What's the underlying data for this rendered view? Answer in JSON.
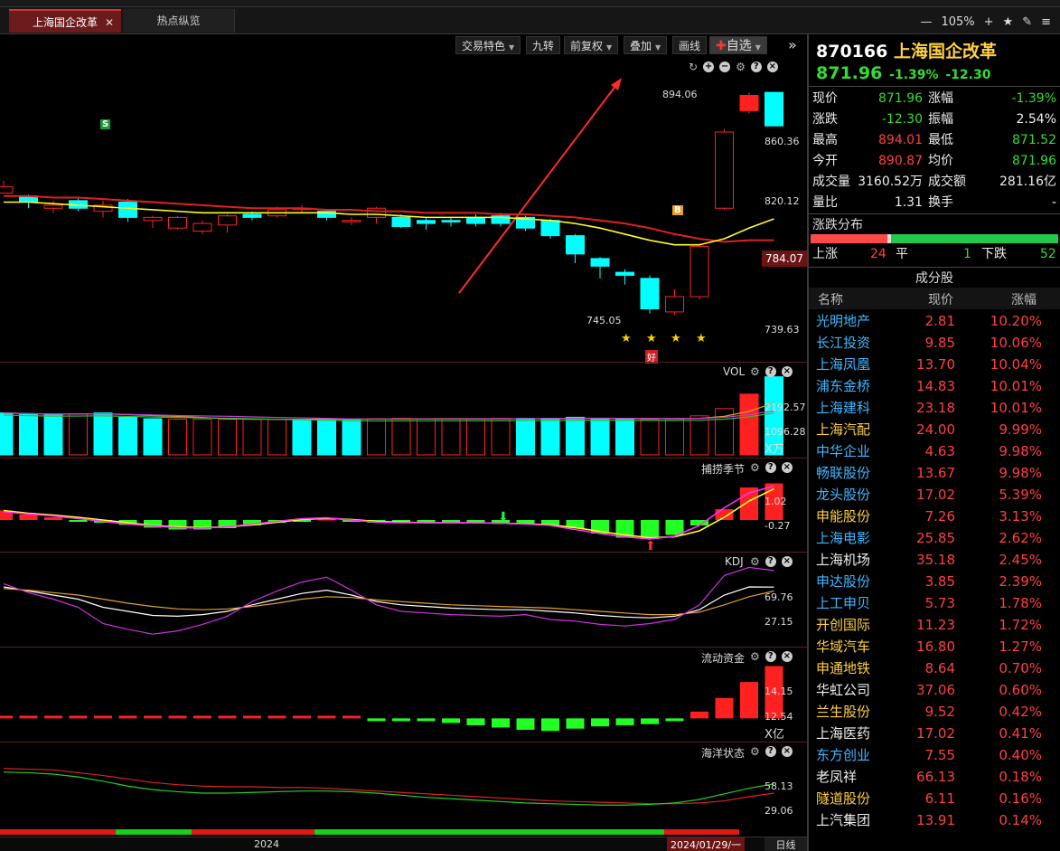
{
  "tabs": [
    {
      "label": "上海国企改革"
    },
    {
      "label": "热点纵览"
    }
  ],
  "zoom": {
    "level": "105%"
  },
  "toolbar": {
    "trade_feature": "交易特色",
    "jiuzhuan": "九转",
    "adjust": "前复权",
    "overlay": "叠加",
    "draw": "画线",
    "watchlist": "自选"
  },
  "header": {
    "code": "870166",
    "name": "上海国企改革",
    "price": "871.96",
    "change_pct": "-1.39%",
    "change": "-12.30"
  },
  "quote": [
    {
      "l1": "现价",
      "v1": "871.96",
      "c1": "green",
      "l2": "涨幅",
      "v2": "-1.39%",
      "c2": "green"
    },
    {
      "l1": "涨跌",
      "v1": "-12.30",
      "c1": "green",
      "l2": "振幅",
      "v2": "2.54%",
      "c2": "white"
    },
    {
      "l1": "最高",
      "v1": "894.01",
      "c1": "red",
      "l2": "最低",
      "v2": "871.52",
      "c2": "green"
    },
    {
      "l1": "今开",
      "v1": "890.87",
      "c1": "red",
      "l2": "均价",
      "v2": "871.96",
      "c2": "green"
    },
    {
      "l1": "成交量",
      "v1": "3160.52万",
      "c1": "white",
      "l2": "成交额",
      "v2": "281.16亿",
      "c2": "white"
    },
    {
      "l1": "量比",
      "v1": "1.31",
      "c1": "white",
      "l2": "换手",
      "v2": "-",
      "c2": "white"
    }
  ],
  "dist": {
    "title": "涨跌分布",
    "up_label": "上涨",
    "up": "24",
    "flat_label": "平",
    "flat": "1",
    "down_label": "下跌",
    "down": "52",
    "up_frac": 0.312,
    "flat_frac": 0.013
  },
  "constituents": {
    "title": "成分股",
    "col_name": "名称",
    "col_price": "现价",
    "col_pct": "涨幅",
    "rows": [
      {
        "name": "光明地产",
        "price": "2.81",
        "pct": "10.20%",
        "nc": "cyan"
      },
      {
        "name": "长江投资",
        "price": "9.85",
        "pct": "10.06%",
        "nc": "cyan"
      },
      {
        "name": "上海凤凰",
        "price": "13.70",
        "pct": "10.04%",
        "nc": "cyan"
      },
      {
        "name": "浦东金桥",
        "price": "14.83",
        "pct": "10.01%",
        "nc": "cyan"
      },
      {
        "name": "上海建科",
        "price": "23.18",
        "pct": "10.01%",
        "nc": "cyan"
      },
      {
        "name": "上海汽配",
        "price": "24.00",
        "pct": "9.99%",
        "nc": "yellow"
      },
      {
        "name": "中华企业",
        "price": "4.63",
        "pct": "9.98%",
        "nc": "cyan"
      },
      {
        "name": "畅联股份",
        "price": "13.67",
        "pct": "9.98%",
        "nc": "cyan"
      },
      {
        "name": "龙头股份",
        "price": "17.02",
        "pct": "5.39%",
        "nc": "cyan"
      },
      {
        "name": "申能股份",
        "price": "7.26",
        "pct": "3.13%",
        "nc": "yellow"
      },
      {
        "name": "上海电影",
        "price": "25.85",
        "pct": "2.62%",
        "nc": "cyan"
      },
      {
        "name": "上海机场",
        "price": "35.18",
        "pct": "2.45%",
        "nc": "white"
      },
      {
        "name": "申达股份",
        "price": "3.85",
        "pct": "2.39%",
        "nc": "cyan"
      },
      {
        "name": "上工申贝",
        "price": "5.73",
        "pct": "1.78%",
        "nc": "cyan"
      },
      {
        "name": "开创国际",
        "price": "11.23",
        "pct": "1.72%",
        "nc": "yellow"
      },
      {
        "name": "华域汽车",
        "price": "16.80",
        "pct": "1.27%",
        "nc": "yellow"
      },
      {
        "name": "申通地铁",
        "price": "8.64",
        "pct": "0.70%",
        "nc": "yellow"
      },
      {
        "name": "华虹公司",
        "price": "37.06",
        "pct": "0.60%",
        "nc": "white"
      },
      {
        "name": "兰生股份",
        "price": "9.52",
        "pct": "0.42%",
        "nc": "yellow"
      },
      {
        "name": "上海医药",
        "price": "17.02",
        "pct": "0.41%",
        "nc": "white"
      },
      {
        "name": "东方创业",
        "price": "7.55",
        "pct": "0.40%",
        "nc": "cyan"
      },
      {
        "name": "老凤祥",
        "price": "66.13",
        "pct": "0.18%",
        "nc": "white"
      },
      {
        "name": "隧道股份",
        "price": "6.11",
        "pct": "0.16%",
        "nc": "yellow"
      },
      {
        "name": "上汽集团",
        "price": "13.91",
        "pct": "0.14%",
        "nc": "white"
      }
    ]
  },
  "main_chart": {
    "ticks": [
      "860.36",
      "820.12",
      "784.07",
      "739.63"
    ],
    "high_label": "894.06",
    "low_label": "745.05",
    "hi_val": 894.06,
    "lo_val": 745.05,
    "good": "好",
    "buy_mark": "B",
    "sell_mark": "S"
  },
  "vol": {
    "title": "VOL",
    "ticks": [
      "2192.57",
      "1096.28"
    ],
    "unit": "X万"
  },
  "season": {
    "title": "捕捞季节",
    "ticks": [
      "1.02",
      "-0.27"
    ]
  },
  "kdj": {
    "title": "KDJ",
    "ticks": [
      "69.76",
      "27.15"
    ]
  },
  "flow": {
    "title": "流动资金",
    "ticks": [
      "14.15",
      "12.54"
    ],
    "unit": "X亿"
  },
  "ocean": {
    "title": "海洋状态",
    "ticks": [
      "58.13",
      "29.06"
    ]
  },
  "bottom": {
    "year": "2024",
    "date": "2024/01/29/一",
    "period": "日线"
  },
  "colors": {
    "up": "#ff2020",
    "down": "#00ffff",
    "accent": "#c33"
  },
  "chart_data": {
    "type": "candlestick",
    "ylim": [
      728,
      900
    ],
    "ohlc": [
      [
        828,
        832,
        836,
        829
      ],
      [
        826,
        822,
        827,
        818
      ],
      [
        818,
        820,
        823,
        815
      ],
      [
        823,
        818,
        825,
        816
      ],
      [
        816,
        820,
        823,
        812
      ],
      [
        822,
        812,
        824,
        809
      ],
      [
        810,
        812,
        813,
        805
      ],
      [
        805,
        812,
        813,
        804
      ],
      [
        803,
        808,
        810,
        801
      ],
      [
        807,
        813,
        814,
        802
      ],
      [
        814,
        812,
        816,
        810
      ],
      [
        813,
        817,
        819,
        812
      ],
      [
        818,
        818,
        820,
        815
      ],
      [
        816,
        812,
        816,
        810
      ],
      [
        810,
        810,
        812,
        807
      ],
      [
        812,
        818,
        819,
        808
      ],
      [
        812,
        806,
        814,
        805
      ],
      [
        810,
        808,
        812,
        804
      ],
      [
        810,
        809,
        812,
        806
      ],
      [
        812,
        808,
        814,
        806
      ],
      [
        813,
        808,
        815,
        806
      ],
      [
        812,
        805,
        813,
        803
      ],
      [
        810,
        800,
        811,
        798
      ],
      [
        800,
        788,
        801,
        782
      ],
      [
        785,
        780,
        786,
        772
      ],
      [
        776,
        774,
        778,
        768
      ],
      [
        772,
        752,
        774,
        749
      ],
      [
        750,
        760,
        765,
        748
      ],
      [
        760,
        793,
        795,
        758
      ],
      [
        818,
        868,
        870,
        817
      ],
      [
        882,
        892,
        894,
        880
      ],
      [
        894,
        872,
        894,
        872
      ]
    ],
    "ma_yellow": [
      822,
      822,
      821,
      820,
      819,
      818,
      817,
      816,
      815,
      815,
      815,
      815,
      815,
      815,
      814,
      814,
      813,
      812,
      812,
      812,
      812,
      811,
      810,
      808,
      805,
      801,
      797,
      794,
      794,
      798,
      805,
      811
    ],
    "ma_red": [
      826,
      826,
      825,
      825,
      824,
      823,
      822,
      821,
      820,
      819,
      818,
      818,
      818,
      817,
      817,
      816,
      816,
      815,
      815,
      815,
      814,
      814,
      813,
      812,
      810,
      808,
      805,
      801,
      798,
      796,
      797,
      797
    ],
    "vol_values": [
      1450,
      1400,
      1380,
      1420,
      1450,
      1300,
      1250,
      1230,
      1230,
      1230,
      1230,
      1230,
      1230,
      1240,
      1240,
      1250,
      1260,
      1250,
      1250,
      1240,
      1260,
      1260,
      1260,
      1300,
      1260,
      1240,
      1230,
      1240,
      1350,
      1600,
      2100,
      2700,
      2892
    ],
    "vol_up": [
      0,
      0,
      0,
      1,
      0,
      0,
      0,
      1,
      1,
      1,
      1,
      1,
      0,
      0,
      0,
      1,
      1,
      1,
      1,
      1,
      1,
      0,
      0,
      0,
      0,
      0,
      1,
      1,
      1,
      1,
      1,
      0
    ],
    "season_bars": [
      0.35,
      0.2,
      0.1,
      -0.05,
      -0.1,
      -0.18,
      -0.28,
      -0.35,
      -0.35,
      -0.3,
      -0.2,
      -0.1,
      0.0,
      0.05,
      -0.05,
      -0.1,
      -0.12,
      -0.1,
      -0.1,
      -0.1,
      -0.12,
      -0.15,
      -0.18,
      -0.3,
      -0.5,
      -0.65,
      -0.7,
      -0.55,
      -0.2,
      0.4,
      1.2,
      1.35
    ],
    "season_line1": [
      0.3,
      0.22,
      0.15,
      0.05,
      -0.05,
      -0.15,
      -0.22,
      -0.28,
      -0.3,
      -0.25,
      -0.15,
      -0.05,
      0.05,
      0.08,
      0.0,
      -0.08,
      -0.1,
      -0.1,
      -0.1,
      -0.1,
      -0.12,
      -0.15,
      -0.2,
      -0.35,
      -0.5,
      -0.62,
      -0.7,
      -0.6,
      -0.2,
      0.45,
      1.0,
      1.25
    ],
    "season_line2": [
      0.35,
      0.25,
      0.18,
      0.1,
      0.0,
      -0.1,
      -0.2,
      -0.25,
      -0.28,
      -0.25,
      -0.18,
      -0.08,
      0.02,
      0.06,
      0.02,
      -0.05,
      -0.08,
      -0.1,
      -0.1,
      -0.1,
      -0.12,
      -0.14,
      -0.18,
      -0.28,
      -0.42,
      -0.55,
      -0.65,
      -0.62,
      -0.4,
      0.1,
      0.7,
      1.15
    ],
    "kdj_k": [
      70,
      65,
      60,
      55,
      45,
      40,
      35,
      34,
      36,
      40,
      48,
      55,
      62,
      66,
      60,
      52,
      48,
      46,
      44,
      43,
      42,
      42,
      40,
      38,
      35,
      33,
      32,
      34,
      42,
      60,
      70,
      69.8
    ],
    "kdj_d": [
      68,
      66,
      63,
      60,
      55,
      50,
      46,
      43,
      42,
      43,
      46,
      50,
      55,
      58,
      57,
      54,
      52,
      50,
      48,
      47,
      46,
      45,
      44,
      42,
      40,
      38,
      36,
      36,
      39,
      48,
      58,
      65
    ],
    "kdj_j": [
      74,
      63,
      55,
      45,
      25,
      18,
      12,
      16,
      24,
      34,
      52,
      65,
      76,
      82,
      66,
      48,
      40,
      38,
      36,
      35,
      34,
      36,
      30,
      28,
      24,
      22,
      25,
      30,
      48,
      84,
      94,
      90
    ],
    "flow_vals": [
      12.4,
      12.5,
      12.55,
      12.6,
      12.65,
      12.6,
      12.5,
      12.45,
      12.4,
      12.4,
      12.42,
      12.42,
      12.4,
      12.35,
      12.3,
      12.25,
      12.22,
      12.2,
      12.1,
      12.0,
      11.9,
      11.8,
      11.75,
      11.85,
      11.95,
      12.0,
      12.05,
      12.2,
      12.6,
      13.2,
      13.9,
      14.6
    ],
    "ocean_red": [
      80,
      79,
      78,
      74,
      70,
      65,
      60,
      57,
      55,
      54,
      54,
      53,
      53,
      52,
      50,
      48,
      46,
      44,
      42,
      40,
      38,
      36,
      34,
      33,
      32,
      31,
      30,
      30,
      31,
      34,
      40,
      45
    ],
    "ocean_green": [
      75,
      74,
      72,
      68,
      62,
      55,
      50,
      47,
      45,
      45,
      46,
      47,
      48,
      48,
      47,
      45,
      42,
      39,
      37,
      35,
      33,
      31,
      30,
      29,
      28,
      28,
      29,
      31,
      36,
      44,
      52,
      58
    ]
  }
}
